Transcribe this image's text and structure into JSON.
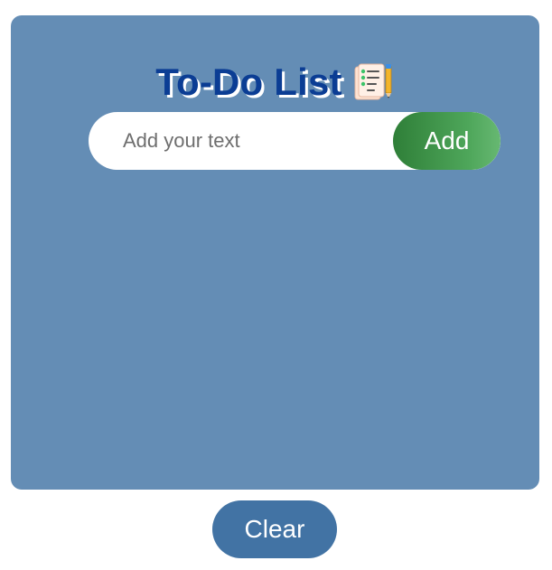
{
  "app": {
    "title": "To-Do List",
    "title_icon": "checklist-with-pencil-icon"
  },
  "input": {
    "value": "",
    "placeholder": "Add your text"
  },
  "add_button": {
    "label": "Add"
  },
  "tasks": [],
  "clear_button": {
    "label": "Clear"
  },
  "colors": {
    "card_background": "#648db5",
    "title_text": "#0b3d94",
    "add_button_start": "#2f7f38",
    "add_button_end": "#67b872",
    "clear_button": "#4273a4",
    "page_background": "#ffffff"
  }
}
